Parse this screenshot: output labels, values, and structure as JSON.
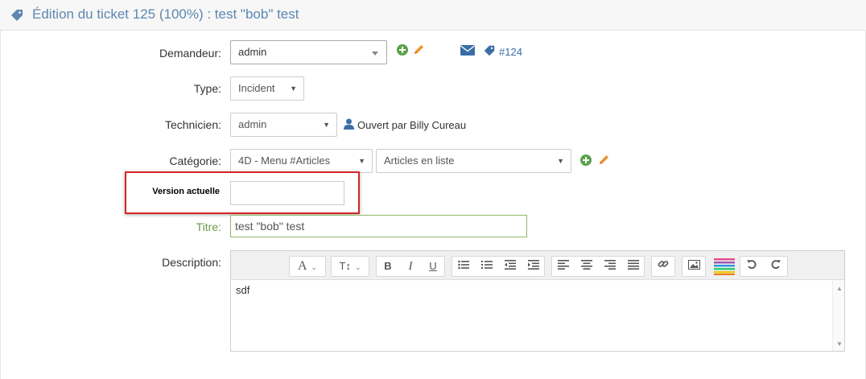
{
  "header": {
    "title": "Édition du ticket 125 (100%) : test \"bob\" test",
    "icon": "ticket-icon"
  },
  "fields": {
    "demandeur": {
      "label": "Demandeur:",
      "value": "admin",
      "linked_ticket": "#124"
    },
    "type": {
      "label": "Type:",
      "value": "Incident"
    },
    "technicien": {
      "label": "Technicien:",
      "value": "admin",
      "opened_by": "Ouvert par Billy Cureau"
    },
    "categorie": {
      "label": "Catégorie:",
      "value": "4D - Menu #Articles",
      "subvalue": "Articles en liste"
    },
    "version": {
      "label": "Version actuelle",
      "value": ""
    },
    "titre": {
      "label": "Titre:",
      "value": "test \"bob\" test"
    },
    "description": {
      "label": "Description:",
      "value": "sdf"
    }
  },
  "toolbar": {
    "font": "A",
    "size": "T↕",
    "bold": "B",
    "italic": "I",
    "underline": "U"
  },
  "colors": {
    "header_title": "#5d87b0",
    "add_green": "#5aa14a",
    "edit_orange": "#f0932a",
    "link_blue": "#3a6ea5",
    "highlight_red": "#d32626",
    "title_green": "#6b9a4d"
  }
}
